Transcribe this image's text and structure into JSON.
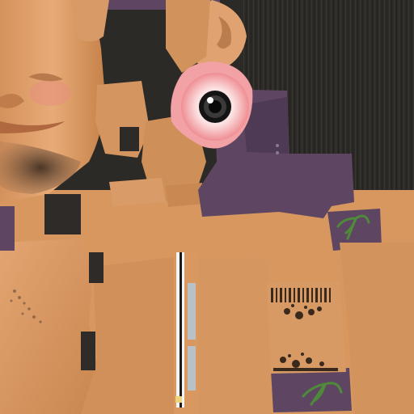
{
  "texture": {
    "kind": "character skin texture atlas",
    "regions": [
      "face",
      "ear",
      "beard",
      "eye",
      "torso",
      "hand",
      "arm",
      "leg",
      "hair",
      "clothing",
      "palm-leaf-print",
      "tattoo",
      "stripe-strip"
    ]
  },
  "colors": {
    "skin_light": "#dfa06e",
    "skin_mid": "#cd8a58",
    "skin_shadow": "#a86a3f",
    "hair_dark": "#2e2b27",
    "background_dark": "#2c2a26",
    "clothing_purple": "#5e4663",
    "clothing_purple_dark": "#4e3a55",
    "eye_pink": "#f2a1a4",
    "eye_white": "#fff2f2",
    "pupil": "#141414",
    "leaf_green": "#4f8a3a",
    "tattoo_ink": "#3a2a1e",
    "beard": "#5e4634",
    "stripe_white": "#f4f4f4",
    "stripe_grey": "#b9c0c6"
  }
}
